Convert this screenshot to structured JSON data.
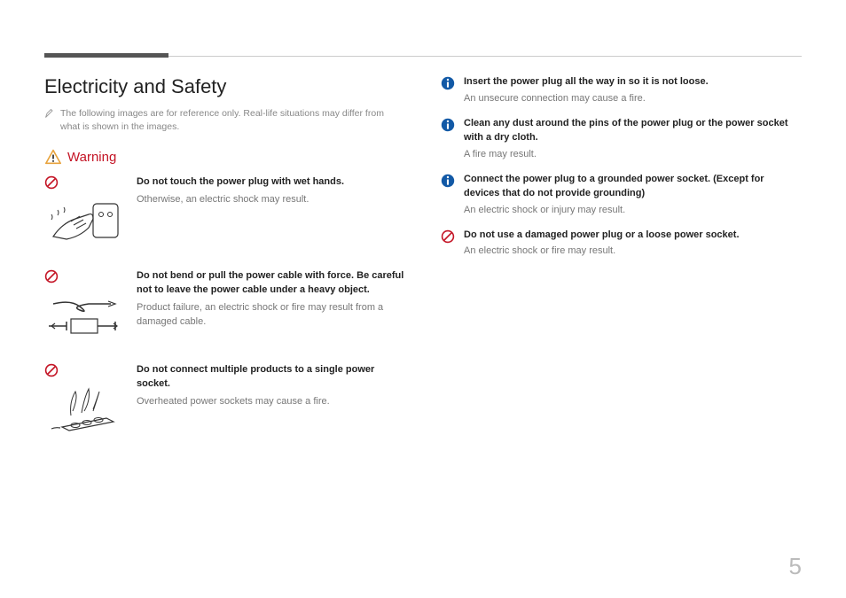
{
  "section_title": "Electricity and Safety",
  "note": "The following images are for reference only. Real-life situations may differ from what is shown in the images.",
  "warning_label": "Warning",
  "left_items": [
    {
      "bold": "Do not touch the power plug with wet hands.",
      "sub": "Otherwise, an electric shock may result."
    },
    {
      "bold": "Do not bend or pull the power cable with force. Be careful not to leave the power cable under a heavy object.",
      "sub": "Product failure, an electric shock or fire may result from a damaged cable."
    },
    {
      "bold": "Do not connect multiple products to a single power socket.",
      "sub": "Overheated power sockets may cause a fire."
    }
  ],
  "right_items": [
    {
      "icon": "info",
      "bold": "Insert the power plug all the way in so it is not loose.",
      "sub": "An unsecure connection may cause a fire."
    },
    {
      "icon": "info",
      "bold": "Clean any dust around the pins of the power plug or the power socket with a dry cloth.",
      "sub": "A fire may result."
    },
    {
      "icon": "info",
      "bold": "Connect the power plug to a grounded power socket. (Except for devices that do not provide grounding)",
      "sub": "An electric shock or injury may result."
    },
    {
      "icon": "prohibit",
      "bold": "Do not use a damaged power plug or a loose power socket.",
      "sub": "An electric shock or fire may result."
    }
  ],
  "page_number": "5"
}
